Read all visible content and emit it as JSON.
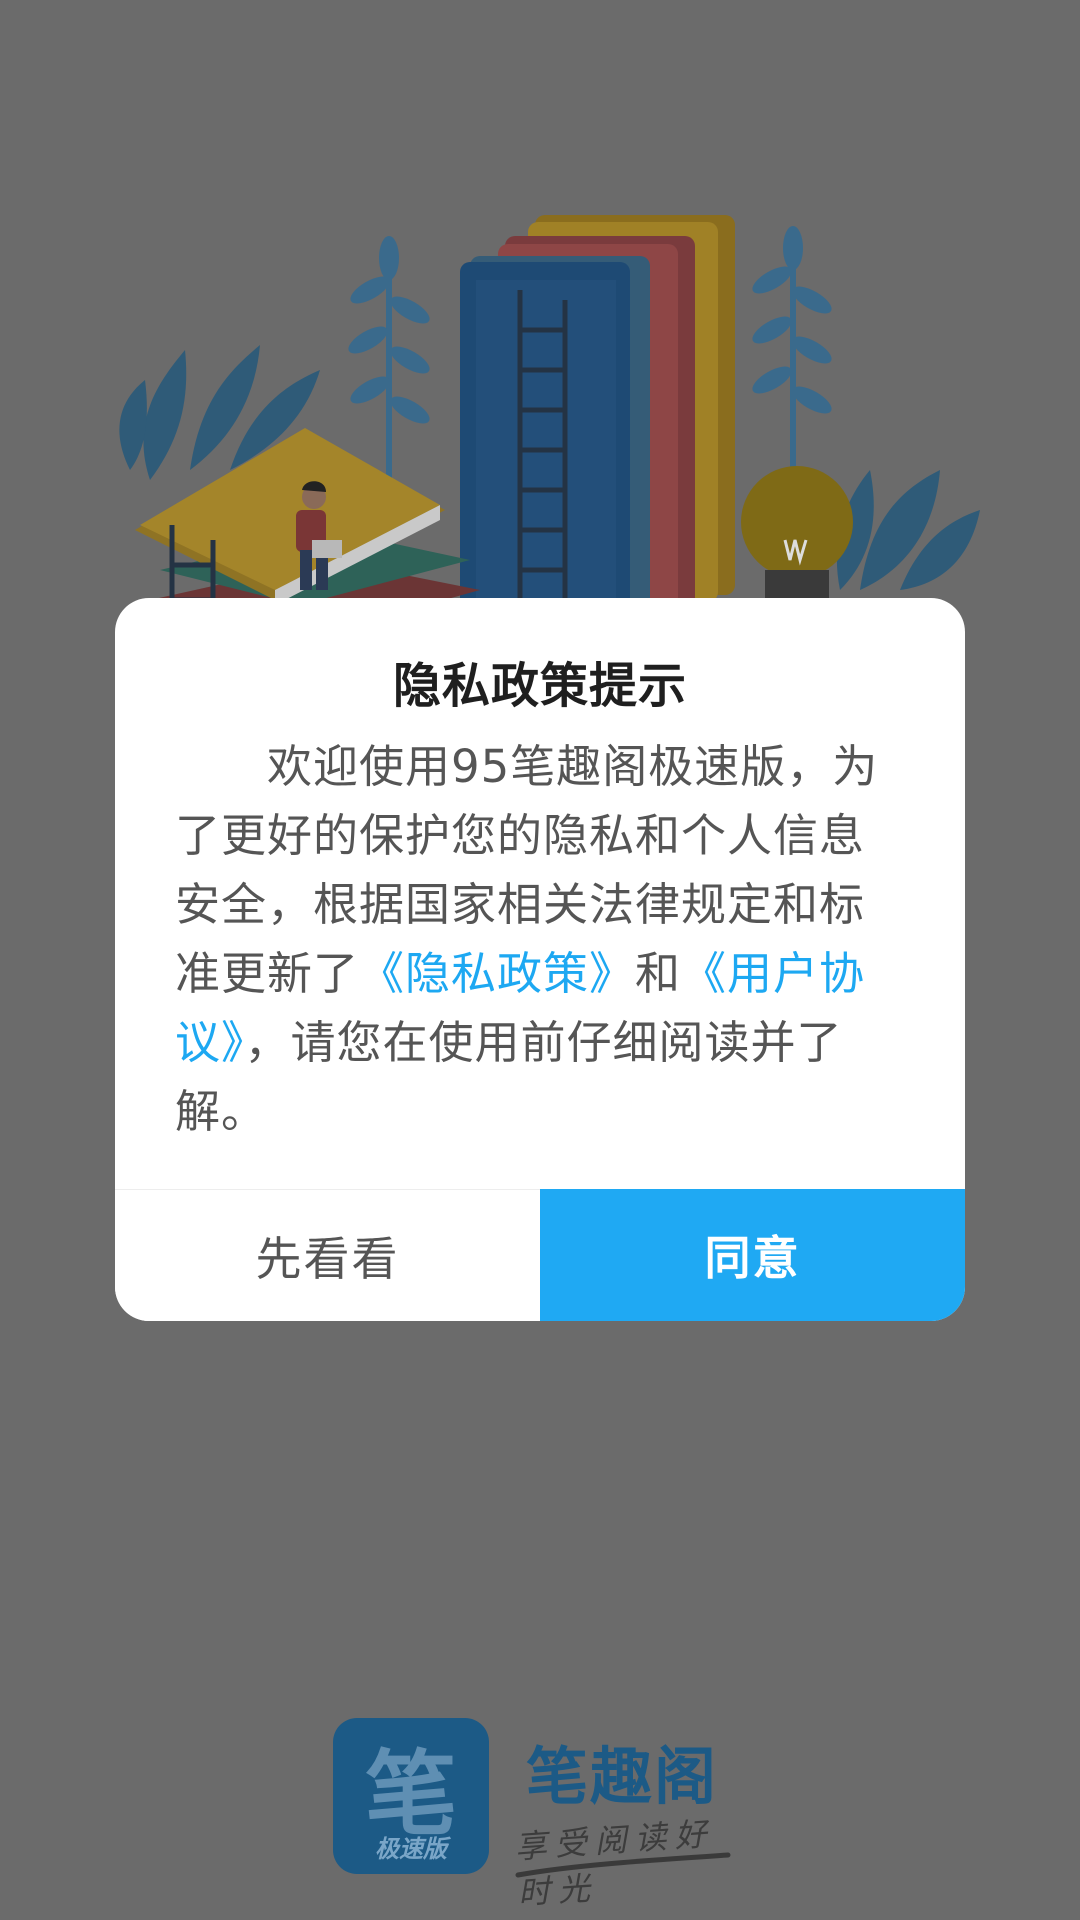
{
  "dialog": {
    "title": "隐私政策提示",
    "body_intro": "欢迎使用95笔趣阁极速版，为了更好的保护您的隐私和个人信息安全，根据国家相关法律规定和标准更新了",
    "privacy_link": "《隐私政策》",
    "and_text": "和",
    "agreement_link": "《用户协议》",
    "body_outro": "，请您在使用前仔细阅读并了解。",
    "later_button": "先看看",
    "agree_button": "同意"
  },
  "brand": {
    "logo_glyph": "笔",
    "logo_label": "极速版",
    "name": "笔趣阁",
    "slogan": "享受阅读好时光"
  },
  "colors": {
    "overlay": "#6b6b6b",
    "accent": "#1fa9f3",
    "link": "#1da8f2",
    "brand_blue": "#1c5a86"
  }
}
